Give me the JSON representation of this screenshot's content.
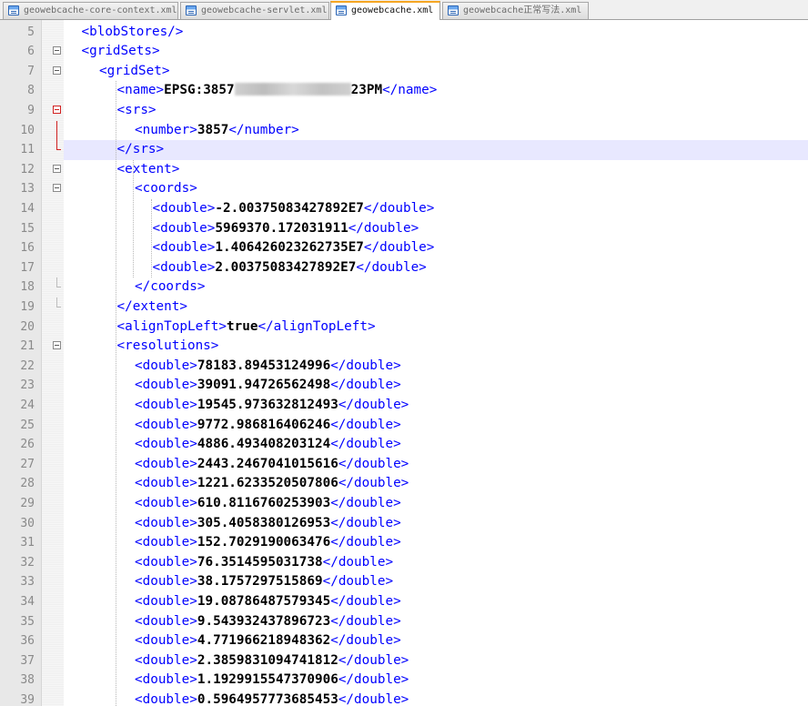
{
  "tabs": [
    {
      "label": "geowebcache-core-context.xml",
      "active": false
    },
    {
      "label": "geowebcache-servlet.xml",
      "active": false
    },
    {
      "label": "geowebcache.xml",
      "active": true
    },
    {
      "label": "geowebcache正常写法.xml",
      "active": false
    }
  ],
  "lines": [
    {
      "n": "5",
      "text": "<blobStores/>"
    },
    {
      "n": "6",
      "text": "<gridSets>"
    },
    {
      "n": "7",
      "text": "<gridSet>"
    },
    {
      "n": "8",
      "open": "<name>",
      "value_before": "EPSG:3857",
      "value_after": "23PM",
      "close": "</name>"
    },
    {
      "n": "9",
      "text": "<srs>"
    },
    {
      "n": "10",
      "open": "<number>",
      "value": "3857",
      "close": "</number>"
    },
    {
      "n": "11",
      "text": "</srs>"
    },
    {
      "n": "12",
      "text": "<extent>"
    },
    {
      "n": "13",
      "text": "<coords>"
    },
    {
      "n": "14",
      "open": "<double>",
      "value": "-2.00375083427892E7",
      "close": "</double>"
    },
    {
      "n": "15",
      "open": "<double>",
      "value": "5969370.172031911",
      "close": "</double>"
    },
    {
      "n": "16",
      "open": "<double>",
      "value": "1.406426023262735E7",
      "close": "</double>"
    },
    {
      "n": "17",
      "open": "<double>",
      "value": "2.00375083427892E7",
      "close": "</double>"
    },
    {
      "n": "18",
      "text": "</coords>"
    },
    {
      "n": "19",
      "text": "</extent>"
    },
    {
      "n": "20",
      "open": "<alignTopLeft>",
      "value": "true",
      "close": "</alignTopLeft>"
    },
    {
      "n": "21",
      "text": "<resolutions>"
    },
    {
      "n": "22",
      "open": "<double>",
      "value": "78183.89453124996",
      "close": "</double>"
    },
    {
      "n": "23",
      "open": "<double>",
      "value": "39091.94726562498",
      "close": "</double>"
    },
    {
      "n": "24",
      "open": "<double>",
      "value": "19545.973632812493",
      "close": "</double>"
    },
    {
      "n": "25",
      "open": "<double>",
      "value": "9772.986816406246",
      "close": "</double>"
    },
    {
      "n": "26",
      "open": "<double>",
      "value": "4886.493408203124",
      "close": "</double>"
    },
    {
      "n": "27",
      "open": "<double>",
      "value": "2443.2467041015616",
      "close": "</double>"
    },
    {
      "n": "28",
      "open": "<double>",
      "value": "1221.6233520507806",
      "close": "</double>"
    },
    {
      "n": "29",
      "open": "<double>",
      "value": "610.8116760253903",
      "close": "</double>"
    },
    {
      "n": "30",
      "open": "<double>",
      "value": "305.4058380126953",
      "close": "</double>"
    },
    {
      "n": "31",
      "open": "<double>",
      "value": "152.7029190063476",
      "close": "</double>"
    },
    {
      "n": "32",
      "open": "<double>",
      "value": "76.3514595031738",
      "close": "</double>"
    },
    {
      "n": "33",
      "open": "<double>",
      "value": "38.1757297515869",
      "close": "</double>"
    },
    {
      "n": "34",
      "open": "<double>",
      "value": "19.08786487579345",
      "close": "</double>"
    },
    {
      "n": "35",
      "open": "<double>",
      "value": "9.543932437896723",
      "close": "</double>"
    },
    {
      "n": "36",
      "open": "<double>",
      "value": "4.771966218948362",
      "close": "</double>"
    },
    {
      "n": "37",
      "open": "<double>",
      "value": "2.3859831094741812",
      "close": "</double>"
    },
    {
      "n": "38",
      "open": "<double>",
      "value": "1.1929915547370906",
      "close": "</double>"
    },
    {
      "n": "39",
      "open": "<double>",
      "value": "0.5964957773685453",
      "close": "</double>"
    }
  ]
}
